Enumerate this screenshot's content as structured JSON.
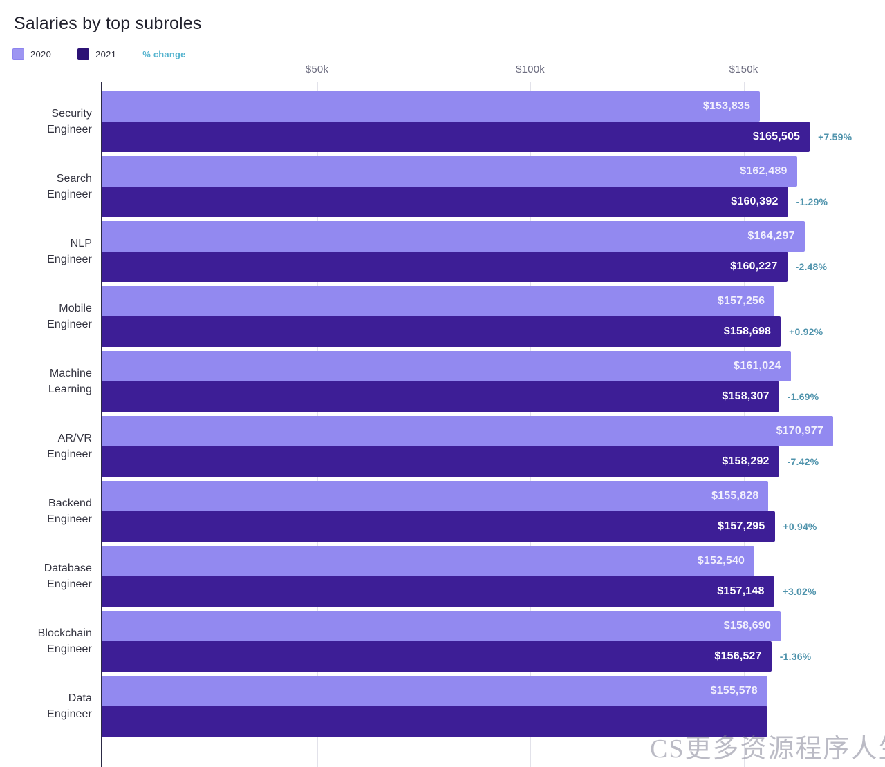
{
  "header": {
    "title": "Salaries by top subroles"
  },
  "legend": {
    "items": [
      {
        "label": "2020",
        "color": "#9289f0",
        "key": "s2020"
      },
      {
        "label": "2021",
        "color": "#3d1e96",
        "key": "s2021"
      }
    ],
    "change_label": "% change",
    "change_color": "#56b4cf"
  },
  "axis": {
    "ticks": [
      {
        "label": "$50k",
        "value": 50000
      },
      {
        "label": "$100k",
        "value": 100000
      },
      {
        "label": "$150k",
        "value": 150000
      }
    ]
  },
  "watermark": {
    "text": "CS更多资源程序人生"
  },
  "chart_data": {
    "type": "bar",
    "orientation": "horizontal",
    "title": "Salaries by top subroles",
    "xlabel": "",
    "ylabel": "",
    "xlim": [
      0,
      180000
    ],
    "grid": true,
    "legend_position": "top-left",
    "categories": [
      "Security Engineer",
      "Search Engineer",
      "NLP Engineer",
      "Mobile Engineer",
      "Machine Learning",
      "AR/VR Engineer",
      "Backend Engineer",
      "Database Engineer",
      "Blockchain Engineer",
      "Data Engineer"
    ],
    "series": [
      {
        "name": "2020",
        "color": "#9289f0",
        "values": [
          153835,
          162489,
          164297,
          157256,
          161024,
          170977,
          155828,
          152540,
          158690,
          155578
        ],
        "labels": [
          "$153,835",
          "$162,489",
          "$164,297",
          "$157,256",
          "$161,024",
          "$170,977",
          "$155,828",
          "$152,540",
          "$158,690",
          "$155,578"
        ]
      },
      {
        "name": "2021",
        "color": "#3d1e96",
        "values": [
          165505,
          160392,
          160227,
          158698,
          158307,
          158292,
          157295,
          157148,
          156527,
          155578
        ],
        "labels": [
          "$165,505",
          "$160,392",
          "$160,227",
          "$158,698",
          "$158,307",
          "$158,292",
          "$157,295",
          "$157,148",
          "$156,527",
          ""
        ]
      }
    ],
    "pct_change": [
      "+7.59%",
      "-1.29%",
      "-2.48%",
      "+0.92%",
      "-1.69%",
      "-7.42%",
      "+0.94%",
      "+3.02%",
      "-1.36%",
      ""
    ],
    "rows": [
      {
        "category_line1": "Security",
        "category_line2": "Engineer"
      },
      {
        "category_line1": "Search",
        "category_line2": "Engineer"
      },
      {
        "category_line1": "NLP",
        "category_line2": "Engineer"
      },
      {
        "category_line1": "Mobile",
        "category_line2": "Engineer"
      },
      {
        "category_line1": "Machine",
        "category_line2": "Learning"
      },
      {
        "category_line1": "AR/VR",
        "category_line2": "Engineer"
      },
      {
        "category_line1": "Backend",
        "category_line2": "Engineer"
      },
      {
        "category_line1": "Database",
        "category_line2": "Engineer"
      },
      {
        "category_line1": "Blockchain",
        "category_line2": "Engineer"
      },
      {
        "category_line1": "Data",
        "category_line2": "Engineer"
      }
    ]
  }
}
